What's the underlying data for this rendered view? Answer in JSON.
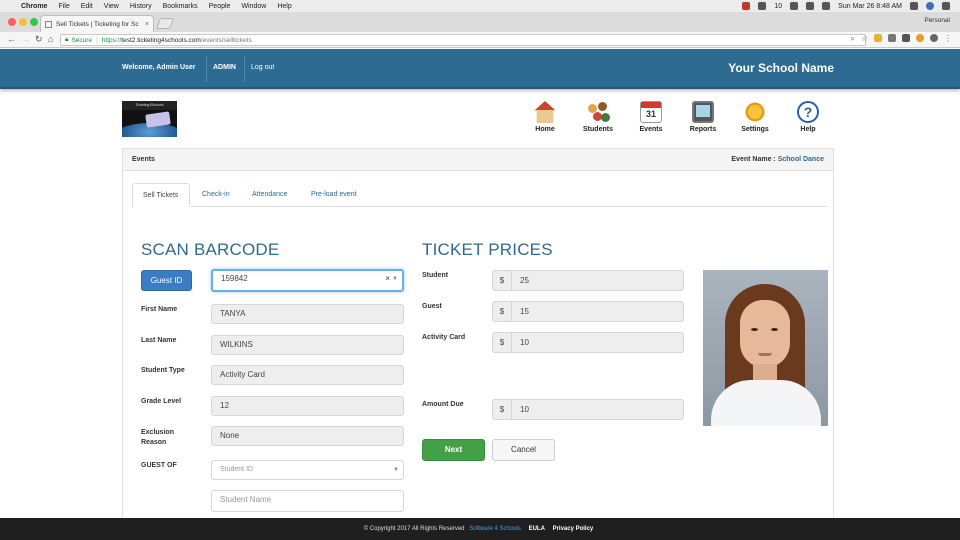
{
  "mac_menu": {
    "app": "Chrome",
    "items": [
      "File",
      "Edit",
      "View",
      "History",
      "Bookmarks",
      "People",
      "Window",
      "Help"
    ],
    "battery_count": "10",
    "datetime": "Sun Mar 26  8:48 AM"
  },
  "browser": {
    "tab_title": "Sell Tickets | Ticketing for Sc",
    "profile": "Personal",
    "url": {
      "secure_label": "Secure",
      "protocol": "https://",
      "host": "test2.ticketing4schools.com",
      "path": "/events/selltickets"
    }
  },
  "header": {
    "welcome": "Welcome, Admin User",
    "role": "ADMIN",
    "logout": "Log out",
    "school_name": "Your School Name"
  },
  "logo": {
    "caption": "Ticketing4Schools"
  },
  "nav": [
    {
      "label": "Home",
      "icon": "home-icon"
    },
    {
      "label": "Students",
      "icon": "students-icon"
    },
    {
      "label": "Events",
      "icon": "calendar-icon",
      "badge": "31"
    },
    {
      "label": "Reports",
      "icon": "monitor-icon"
    },
    {
      "label": "Settings",
      "icon": "gear-icon"
    },
    {
      "label": "Help",
      "icon": "help-icon"
    }
  ],
  "panel": {
    "title": "Events",
    "event_label": "Event Name :",
    "event_name": "School Dance"
  },
  "tabs": [
    "Sell Tickets",
    "Check-in",
    "Attendance",
    "Pre-load event"
  ],
  "scan": {
    "heading": "SCAN BARCODE",
    "guest_id_button": "Guest ID",
    "barcode_value": "159842",
    "labels": {
      "first_name": "First Name",
      "last_name": "Last Name",
      "student_type": "Student Type",
      "grade_level": "Grade Level",
      "exclusion_reason_1": "Exclusion",
      "exclusion_reason_2": "Reason",
      "guest_of": "GUEST OF"
    },
    "values": {
      "first_name": "TANYA",
      "last_name": "WILKINS",
      "student_type": "Activity Card",
      "grade_level": "12",
      "exclusion_reason": "None"
    },
    "guest_of_placeholder": "Student ID",
    "student_name_placeholder": "Student Name"
  },
  "prices": {
    "heading": "TICKET PRICES",
    "currency": "$",
    "rows": [
      {
        "label": "Student",
        "value": "25"
      },
      {
        "label": "Guest",
        "value": "15"
      },
      {
        "label": "Activity Card",
        "value": "10"
      }
    ],
    "amount_due_label": "Amount Due",
    "amount_due": "10",
    "next": "Next",
    "cancel": "Cancel"
  },
  "footer": {
    "copyright": "© Copyright 2017 All Rights Reserved",
    "brand": "Software 4 Schools",
    "eula": "EULA",
    "privacy": "Privacy Policy"
  }
}
